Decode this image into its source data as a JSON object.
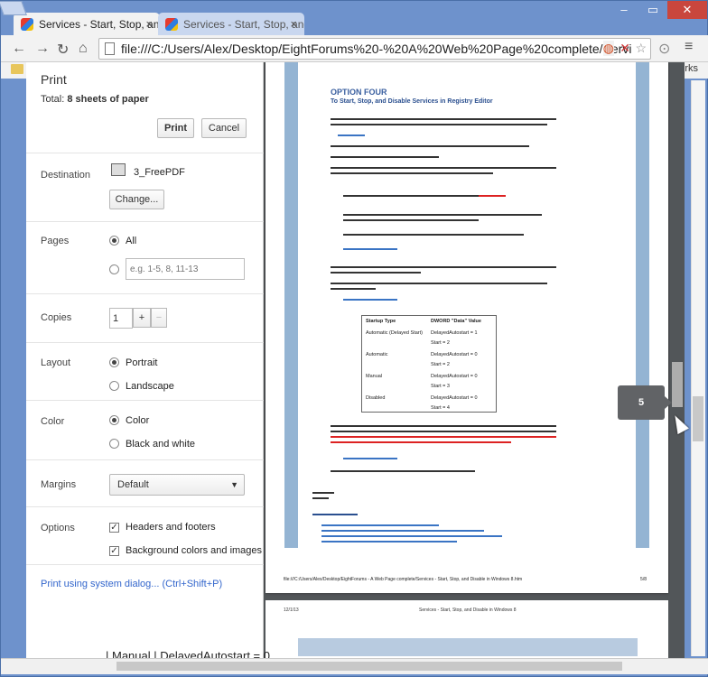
{
  "browser": {
    "tabs": [
      {
        "title": "Services - Start, Stop, and"
      },
      {
        "title": "Services - Start, Stop, and"
      }
    ],
    "address": "file:///C:/Users/Alex/Desktop/EightForums%20-%20A%20Web%20Page%20complete/Servi",
    "bookmarks_right": "rks"
  },
  "print": {
    "title": "Print",
    "total_label": "Total:",
    "total_value": "8 sheets of paper",
    "print_button": "Print",
    "cancel_button": "Cancel",
    "destination_label": "Destination",
    "destination_value": "3_FreePDF",
    "change_button": "Change...",
    "pages_label": "Pages",
    "pages_all": "All",
    "pages_placeholder": "e.g. 1-5, 8, 11-13",
    "copies_label": "Copies",
    "copies_value": "1",
    "layout_label": "Layout",
    "layout_portrait": "Portrait",
    "layout_landscape": "Landscape",
    "color_label": "Color",
    "color_color": "Color",
    "color_bw": "Black and white",
    "margins_label": "Margins",
    "margins_value": "Default",
    "options_label": "Options",
    "opt_headers": "Headers and footers",
    "opt_background": "Background colors and images",
    "system_dialog": "Print using system dialog... (Ctrl+Shift+P)"
  },
  "preview": {
    "option_title": "OPTION FOUR",
    "option_subtitle": "To Start, Stop, and Disable Services in Registry Editor",
    "table": {
      "headers": [
        "Startup Type",
        "DWORD \"Data\" Value"
      ],
      "rows": [
        [
          "Automatic (Delayed Start)",
          "DelayedAutostart = 1",
          "Start = 2"
        ],
        [
          "Automatic",
          "DelayedAutostart = 0",
          "Start = 2"
        ],
        [
          "Manual",
          "DelayedAutostart = 0",
          "Start = 3"
        ],
        [
          "Disabled",
          "DelayedAutostart = 0",
          "Start = 4"
        ]
      ]
    },
    "footer_path": "file:///C:/Users/Alex/Desktop/EightForums - A Web Page complete/Services - Start, Stop, and Disable in Windows 8.htm",
    "footer_page": "5/8",
    "page2_date": "12/1/13",
    "page2_title": "Services - Start, Stop, and Disable in Windows 8",
    "page_bubble": "5",
    "behind_text": "| Manual          | DelayedAutostart = 0"
  }
}
